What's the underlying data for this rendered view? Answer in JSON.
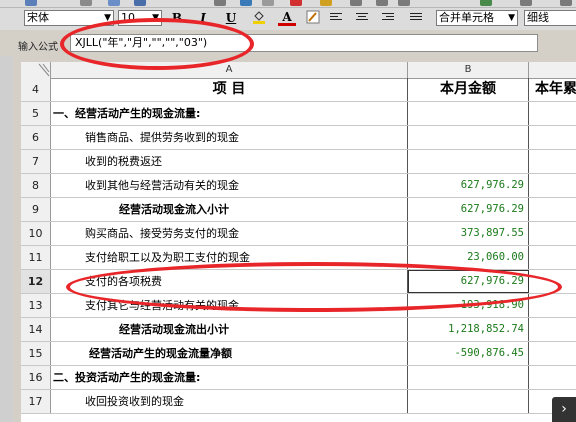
{
  "toolbar": {
    "font_name": "宋体",
    "font_size": "10",
    "bold_label": "B",
    "italic_label": "I",
    "underline_label": "U",
    "font_color_label": "A",
    "merge_combo": "合并单元格",
    "border_combo": "细线"
  },
  "formula_bar": {
    "label": "输入公式",
    "value": "XJLL(\"年\",\"月\",\"\",\"\",\"03\")"
  },
  "grid": {
    "col_headers": [
      "A",
      "B"
    ],
    "rows": [
      {
        "num": "4",
        "a": "项    目",
        "b": "本月金额",
        "c": "本年累",
        "type": "header"
      },
      {
        "num": "5",
        "a": "一、经营活动产生的现金流量:",
        "b": "",
        "type": "bold"
      },
      {
        "num": "6",
        "a": "销售商品、提供劳务收到的现金",
        "b": "",
        "type": "indent"
      },
      {
        "num": "7",
        "a": "收到的税费返还",
        "b": "",
        "type": "indent"
      },
      {
        "num": "8",
        "a": "收到其他与经营活动有关的现金",
        "b": "627,976.29",
        "type": "indent"
      },
      {
        "num": "9",
        "a": "经营活动现金流入小计",
        "b": "627,976.29",
        "type": "subtotal"
      },
      {
        "num": "10",
        "a": "购买商品、接受劳务支付的现金",
        "b": "373,897.55",
        "type": "indent"
      },
      {
        "num": "11",
        "a": "支付给职工以及为职工支付的现金",
        "b": "23,060.00",
        "type": "indent"
      },
      {
        "num": "12",
        "a": "支付的各项税费",
        "b": "627,976.29",
        "type": "indent"
      },
      {
        "num": "13",
        "a": "支付其它与经营活动有关的现金",
        "b": "193,918.90",
        "type": "indent"
      },
      {
        "num": "14",
        "a": "经营活动现金流出小计",
        "b": "1,218,852.74",
        "type": "subtotal"
      },
      {
        "num": "15",
        "a": "经营活动产生的现金流量净额",
        "b": "-590,876.45",
        "type": "subtotal2"
      },
      {
        "num": "16",
        "a": "二、投资活动产生的现金流量:",
        "b": "",
        "type": "bold"
      },
      {
        "num": "17",
        "a": "收回投资收到的现金",
        "b": "",
        "type": "indent"
      }
    ]
  },
  "colors": {
    "value_green": "#1a7a1a",
    "annotation_red": "#e8262a"
  }
}
